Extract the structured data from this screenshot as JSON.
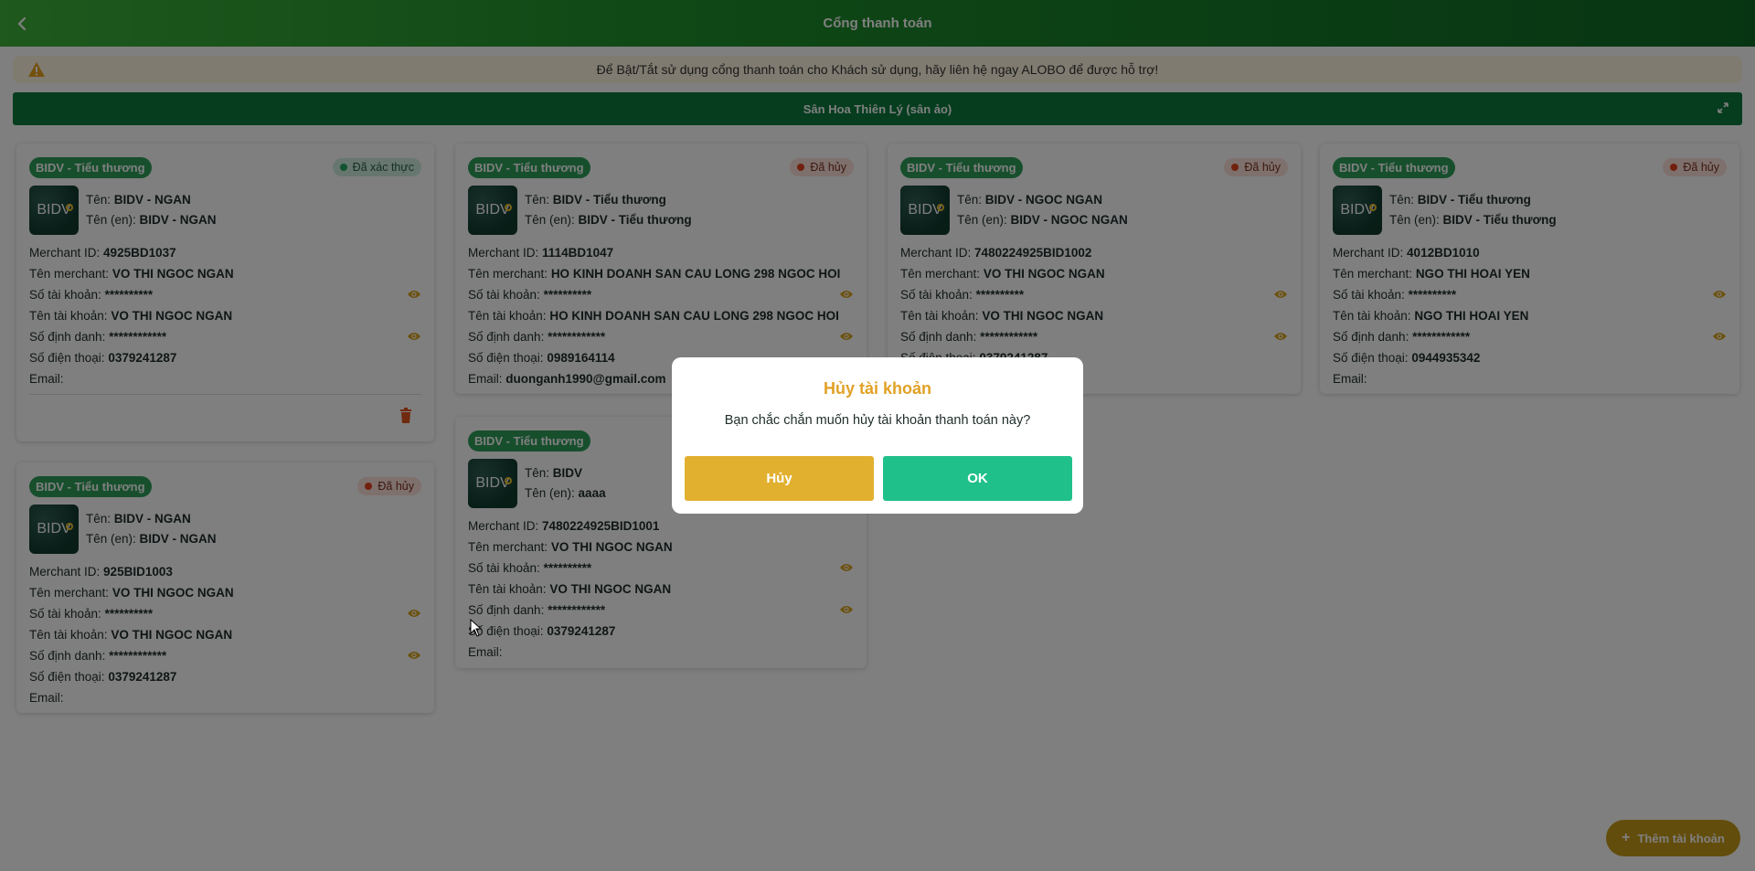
{
  "header": {
    "title": "Cổng thanh toán"
  },
  "notice": {
    "text": "Để Bật/Tắt sử dụng cổng thanh toán cho Khách sử dụng, hãy liên hệ ngay ALOBO để được hỗ trợ!"
  },
  "venue": {
    "name": "Sân Hoa Thiên Lý (sân ảo)"
  },
  "labels": {
    "ten": "Tên:",
    "ten_en": "Tên (en):",
    "merchant_id": "Merchant ID:",
    "ten_merchant": "Tên merchant:",
    "so_tk": "Số tài khoản:",
    "ten_tk": "Tên tài khoản:",
    "so_dinh_danh": "Số định danh:",
    "so_dt": "Số điện thoại:",
    "email": "Email:"
  },
  "logo_text": "BIDV",
  "cards": [
    {
      "tag": "BIDV - Tiểu thương",
      "status": "Đã xác thực",
      "ten": "BIDV - NGAN",
      "ten_en": "BIDV - NGAN",
      "merchant_id": "4925BD1037",
      "ten_merchant": "VO THI NGOC NGAN",
      "so_tk": "**********",
      "ten_tk": "VO THI NGOC NGAN",
      "so_dinh_danh": "************",
      "so_dt": "0379241287",
      "email": ""
    },
    {
      "tag": "BIDV - Tiểu thương",
      "status": "Đã hủy",
      "ten": "BIDV - Tiểu thương",
      "ten_en": "BIDV - Tiểu thương",
      "merchant_id": "1114BD1047",
      "ten_merchant": "HO KINH DOANH SAN CAU LONG 298 NGOC HOI",
      "so_tk": "**********",
      "ten_tk": "HO KINH DOANH SAN CAU LONG 298 NGOC HOI",
      "so_dinh_danh": "************",
      "so_dt": "0989164114",
      "email": "duonganh1990@gmail.com"
    },
    {
      "tag": "BIDV - Tiểu thương",
      "status": "Đã hủy",
      "ten": "BIDV - NGOC NGAN",
      "ten_en": "BIDV - NGOC NGAN",
      "merchant_id": "7480224925BID1002",
      "ten_merchant": "VO THI NGOC NGAN",
      "so_tk": "**********",
      "ten_tk": "VO THI NGOC NGAN",
      "so_dinh_danh": "************",
      "so_dt": "0379241287",
      "email": ""
    },
    {
      "tag": "BIDV - Tiểu thương",
      "status": "Đã hủy",
      "ten": "BIDV - Tiểu thương",
      "ten_en": "BIDV - Tiểu thương",
      "merchant_id": "4012BD1010",
      "ten_merchant": "NGO THI HOAI YEN",
      "so_tk": "**********",
      "ten_tk": "NGO THI HOAI YEN",
      "so_dinh_danh": "************",
      "so_dt": "0944935342",
      "email": ""
    },
    {
      "tag": "BIDV - Tiểu thương",
      "status": "Đã hủy",
      "ten": "BIDV - NGAN",
      "ten_en": "BIDV - NGAN",
      "merchant_id": "925BID1003",
      "ten_merchant": "VO THI NGOC NGAN",
      "so_tk": "**********",
      "ten_tk": "VO THI NGOC NGAN",
      "so_dinh_danh": "************",
      "so_dt": "0379241287",
      "email": ""
    },
    {
      "tag": "BIDV - Tiểu thương",
      "status": "",
      "ten": "BIDV",
      "ten_en": "aaaa",
      "merchant_id": "7480224925BID1001",
      "ten_merchant": "VO THI NGOC NGAN",
      "so_tk": "**********",
      "ten_tk": "VO THI NGOC NGAN",
      "so_dinh_danh": "************",
      "so_dt": "0379241287",
      "email": ""
    }
  ],
  "fab": {
    "label": "Thêm tài khoản"
  },
  "modal": {
    "title": "Hủy tài khoản",
    "message": "Bạn chắc chắn muốn hủy tài khoản thanh toán này?",
    "cancel": "Hủy",
    "ok": "OK"
  },
  "colors": {
    "header_start": "#3fb23a",
    "header_end": "#0f6b26",
    "venue_bar": "#0a7a3c",
    "tag": "#2e9e5a",
    "modal_title": "#e2a126",
    "btn_cancel": "#e2b02f",
    "btn_ok": "#20c08b",
    "fab": "#c79a19"
  }
}
